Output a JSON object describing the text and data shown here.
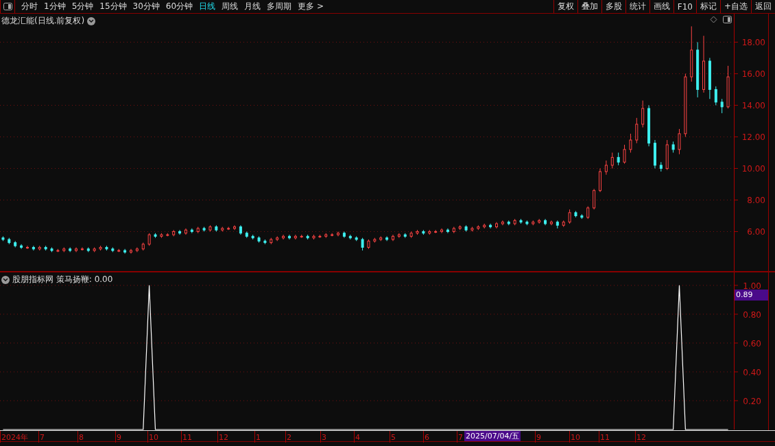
{
  "toolbar": {
    "periods": [
      {
        "label": "分时",
        "selected": false
      },
      {
        "label": "1分钟",
        "selected": false
      },
      {
        "label": "5分钟",
        "selected": false
      },
      {
        "label": "15分钟",
        "selected": false
      },
      {
        "label": "30分钟",
        "selected": false
      },
      {
        "label": "60分钟",
        "selected": false
      },
      {
        "label": "日线",
        "selected": true
      },
      {
        "label": "周线",
        "selected": false
      },
      {
        "label": "月线",
        "selected": false
      },
      {
        "label": "多周期",
        "selected": false
      }
    ],
    "more": "更多 >",
    "buttons": [
      "复权",
      "叠加",
      "多股",
      "统计",
      "画线",
      "F10",
      "标记",
      "+自选",
      "返回"
    ]
  },
  "main_chart": {
    "title": "德龙汇能(日线.前复权)",
    "cursor_date": "2025/07/04/五",
    "x_axis_labels": [
      "2024年",
      "7",
      "8",
      "9",
      "10",
      "11",
      "12",
      "1",
      "2",
      "3",
      "4",
      "5",
      "6",
      "7",
      "9",
      "10",
      "11",
      "12"
    ],
    "chart_data": {
      "type": "candlestick",
      "grid": true,
      "ylim": [
        3.5,
        19.8
      ],
      "yticks": [
        {
          "value": 6,
          "label": "6.00"
        },
        {
          "value": 8,
          "label": "8.00"
        },
        {
          "value": 10,
          "label": "10.00"
        },
        {
          "value": 12,
          "label": "12.00"
        },
        {
          "value": 14,
          "label": "14.00"
        },
        {
          "value": 16,
          "label": "16.00"
        },
        {
          "value": 18,
          "label": "18.00"
        }
      ],
      "ohlc": [
        [
          5.6,
          5.7,
          5.4,
          5.5
        ],
        [
          5.5,
          5.6,
          5.2,
          5.3
        ],
        [
          5.3,
          5.4,
          5.0,
          5.1
        ],
        [
          5.1,
          5.2,
          4.9,
          5.0
        ],
        [
          5.0,
          5.1,
          4.9,
          5.0
        ],
        [
          5.0,
          5.1,
          4.8,
          4.9
        ],
        [
          4.9,
          5.1,
          4.8,
          5.0
        ],
        [
          5.0,
          5.1,
          4.8,
          4.9
        ],
        [
          4.9,
          5.0,
          4.7,
          4.8
        ],
        [
          4.8,
          4.9,
          4.7,
          4.8
        ],
        [
          4.8,
          5.0,
          4.7,
          4.9
        ],
        [
          4.9,
          5.0,
          4.7,
          4.8
        ],
        [
          4.8,
          5.0,
          4.7,
          4.9
        ],
        [
          4.9,
          5.0,
          4.8,
          4.9
        ],
        [
          4.9,
          5.0,
          4.7,
          4.8
        ],
        [
          4.8,
          5.0,
          4.7,
          4.9
        ],
        [
          4.9,
          5.1,
          4.8,
          5.0
        ],
        [
          5.0,
          5.1,
          4.8,
          4.9
        ],
        [
          4.9,
          5.0,
          4.7,
          4.8
        ],
        [
          4.8,
          4.9,
          4.7,
          4.8
        ],
        [
          4.8,
          4.9,
          4.6,
          4.7
        ],
        [
          4.7,
          4.9,
          4.6,
          4.8
        ],
        [
          4.8,
          5.0,
          4.7,
          4.9
        ],
        [
          4.9,
          5.3,
          4.8,
          5.2
        ],
        [
          5.2,
          5.9,
          5.1,
          5.8
        ],
        [
          5.8,
          5.9,
          5.6,
          5.7
        ],
        [
          5.7,
          5.9,
          5.6,
          5.8
        ],
        [
          5.8,
          5.9,
          5.7,
          5.8
        ],
        [
          5.8,
          6.1,
          5.7,
          6.0
        ],
        [
          6.0,
          6.1,
          5.8,
          5.9
        ],
        [
          5.9,
          6.2,
          5.8,
          6.1
        ],
        [
          6.1,
          6.2,
          5.9,
          6.0
        ],
        [
          6.0,
          6.3,
          5.9,
          6.2
        ],
        [
          6.2,
          6.3,
          6.0,
          6.1
        ],
        [
          6.1,
          6.4,
          6.0,
          6.3
        ],
        [
          6.3,
          6.4,
          6.0,
          6.1
        ],
        [
          6.1,
          6.3,
          6.0,
          6.2
        ],
        [
          6.2,
          6.3,
          6.1,
          6.2
        ],
        [
          6.2,
          6.4,
          6.1,
          6.3
        ],
        [
          6.3,
          6.4,
          5.8,
          5.9
        ],
        [
          5.9,
          6.0,
          5.6,
          5.7
        ],
        [
          5.7,
          5.8,
          5.5,
          5.6
        ],
        [
          5.6,
          5.7,
          5.3,
          5.4
        ],
        [
          5.4,
          5.5,
          5.2,
          5.3
        ],
        [
          5.3,
          5.6,
          5.2,
          5.5
        ],
        [
          5.5,
          5.7,
          5.4,
          5.6
        ],
        [
          5.6,
          5.8,
          5.5,
          5.7
        ],
        [
          5.7,
          5.8,
          5.5,
          5.6
        ],
        [
          5.6,
          5.8,
          5.5,
          5.7
        ],
        [
          5.7,
          5.8,
          5.6,
          5.7
        ],
        [
          5.7,
          5.8,
          5.5,
          5.6
        ],
        [
          5.6,
          5.8,
          5.5,
          5.7
        ],
        [
          5.7,
          5.8,
          5.6,
          5.7
        ],
        [
          5.7,
          5.9,
          5.6,
          5.8
        ],
        [
          5.8,
          5.9,
          5.7,
          5.8
        ],
        [
          5.8,
          6.0,
          5.7,
          5.9
        ],
        [
          5.9,
          6.0,
          5.6,
          5.7
        ],
        [
          5.7,
          5.8,
          5.5,
          5.6
        ],
        [
          5.6,
          5.7,
          5.4,
          5.5
        ],
        [
          5.5,
          5.6,
          4.8,
          5.0
        ],
        [
          5.0,
          5.5,
          4.9,
          5.4
        ],
        [
          5.4,
          5.6,
          5.3,
          5.5
        ],
        [
          5.5,
          5.7,
          5.4,
          5.6
        ],
        [
          5.6,
          5.7,
          5.4,
          5.5
        ],
        [
          5.5,
          5.8,
          5.4,
          5.7
        ],
        [
          5.7,
          5.9,
          5.6,
          5.8
        ],
        [
          5.8,
          5.9,
          5.6,
          5.7
        ],
        [
          5.7,
          6.0,
          5.6,
          5.9
        ],
        [
          5.9,
          6.1,
          5.8,
          6.0
        ],
        [
          6.0,
          6.1,
          5.8,
          5.9
        ],
        [
          5.9,
          6.1,
          5.8,
          6.0
        ],
        [
          6.0,
          6.1,
          5.9,
          6.0
        ],
        [
          6.0,
          6.2,
          5.9,
          6.1
        ],
        [
          6.1,
          6.2,
          5.9,
          6.0
        ],
        [
          6.0,
          6.3,
          5.9,
          6.2
        ],
        [
          6.2,
          6.4,
          6.1,
          6.3
        ],
        [
          6.3,
          6.4,
          6.0,
          6.1
        ],
        [
          6.1,
          6.3,
          6.0,
          6.2
        ],
        [
          6.2,
          6.4,
          6.1,
          6.3
        ],
        [
          6.3,
          6.5,
          6.2,
          6.4
        ],
        [
          6.4,
          6.5,
          6.2,
          6.3
        ],
        [
          6.3,
          6.6,
          6.2,
          6.5
        ],
        [
          6.5,
          6.7,
          6.4,
          6.6
        ],
        [
          6.6,
          6.7,
          6.4,
          6.5
        ],
        [
          6.5,
          6.8,
          6.4,
          6.7
        ],
        [
          6.7,
          6.8,
          6.5,
          6.6
        ],
        [
          6.6,
          6.7,
          6.4,
          6.5
        ],
        [
          6.5,
          6.7,
          6.4,
          6.6
        ],
        [
          6.6,
          6.8,
          6.5,
          6.7
        ],
        [
          6.7,
          6.8,
          6.4,
          6.5
        ],
        [
          6.5,
          6.7,
          6.4,
          6.6
        ],
        [
          6.6,
          6.7,
          6.2,
          6.4
        ],
        [
          6.4,
          6.7,
          6.3,
          6.6
        ],
        [
          6.6,
          7.4,
          6.5,
          7.2
        ],
        [
          7.2,
          7.3,
          6.9,
          7.0
        ],
        [
          7.0,
          7.1,
          6.8,
          6.9
        ],
        [
          6.9,
          7.6,
          6.8,
          7.5
        ],
        [
          7.5,
          8.7,
          7.4,
          8.6
        ],
        [
          8.6,
          10.0,
          8.5,
          9.8
        ],
        [
          9.8,
          10.5,
          9.6,
          10.2
        ],
        [
          10.2,
          11.0,
          10.0,
          10.7
        ],
        [
          10.7,
          11.0,
          10.2,
          10.4
        ],
        [
          10.4,
          11.5,
          10.3,
          11.2
        ],
        [
          11.2,
          12.2,
          11.0,
          11.8
        ],
        [
          11.8,
          13.2,
          11.6,
          12.8
        ],
        [
          12.8,
          14.3,
          12.6,
          13.8
        ],
        [
          13.8,
          14.0,
          11.4,
          11.6
        ],
        [
          11.6,
          11.8,
          10.0,
          10.2
        ],
        [
          10.2,
          10.4,
          9.8,
          10.0
        ],
        [
          10.0,
          11.8,
          9.9,
          11.5
        ],
        [
          11.5,
          11.7,
          11.0,
          11.2
        ],
        [
          11.2,
          12.5,
          10.9,
          12.2
        ],
        [
          12.2,
          16.0,
          12.0,
          15.8
        ],
        [
          15.8,
          19.0,
          15.5,
          17.5
        ],
        [
          17.5,
          18.0,
          14.5,
          15.0
        ],
        [
          15.0,
          18.4,
          14.8,
          16.8
        ],
        [
          16.8,
          17.0,
          14.4,
          15.0
        ],
        [
          15.0,
          15.2,
          14.0,
          14.2
        ],
        [
          14.2,
          14.4,
          13.5,
          13.9
        ],
        [
          13.9,
          16.5,
          13.8,
          15.8
        ]
      ]
    }
  },
  "indicator": {
    "title": "股朋指标网 策马扬鞭: 0.00",
    "cursor_value": "0.89",
    "chart_data": {
      "type": "line",
      "grid": true,
      "ylim": [
        0,
        1.09
      ],
      "yticks": [
        {
          "value": 0.2,
          "label": "0.20"
        },
        {
          "value": 0.4,
          "label": "0.40"
        },
        {
          "value": 0.6,
          "label": "0.60"
        },
        {
          "value": 0.8,
          "label": "0.80"
        },
        {
          "value": 1.0,
          "label": "1.00"
        }
      ],
      "series": [
        {
          "values": [
            0,
            0,
            0,
            0,
            0,
            0,
            0,
            0,
            0,
            0,
            0,
            0,
            0,
            0,
            0,
            0,
            0,
            0,
            0,
            0,
            0,
            0,
            0,
            0,
            1,
            0,
            0,
            0,
            0,
            0,
            0,
            0,
            0,
            0,
            0,
            0,
            0,
            0,
            0,
            0,
            0,
            0,
            0,
            0,
            0,
            0,
            0,
            0,
            0,
            0,
            0,
            0,
            0,
            0,
            0,
            0,
            0,
            0,
            0,
            0,
            0,
            0,
            0,
            0,
            0,
            0,
            0,
            0,
            0,
            0,
            0,
            0,
            0,
            0,
            0,
            0,
            0,
            0,
            0,
            0,
            0,
            0,
            0,
            0,
            0,
            0,
            0,
            0,
            0,
            0,
            0,
            0,
            0,
            0,
            0,
            0,
            0,
            0,
            0,
            0,
            0,
            0,
            0,
            0,
            0,
            0,
            0,
            0,
            0,
            0,
            0,
            1,
            0,
            0,
            0,
            0,
            0,
            0,
            0,
            0
          ]
        }
      ]
    }
  }
}
